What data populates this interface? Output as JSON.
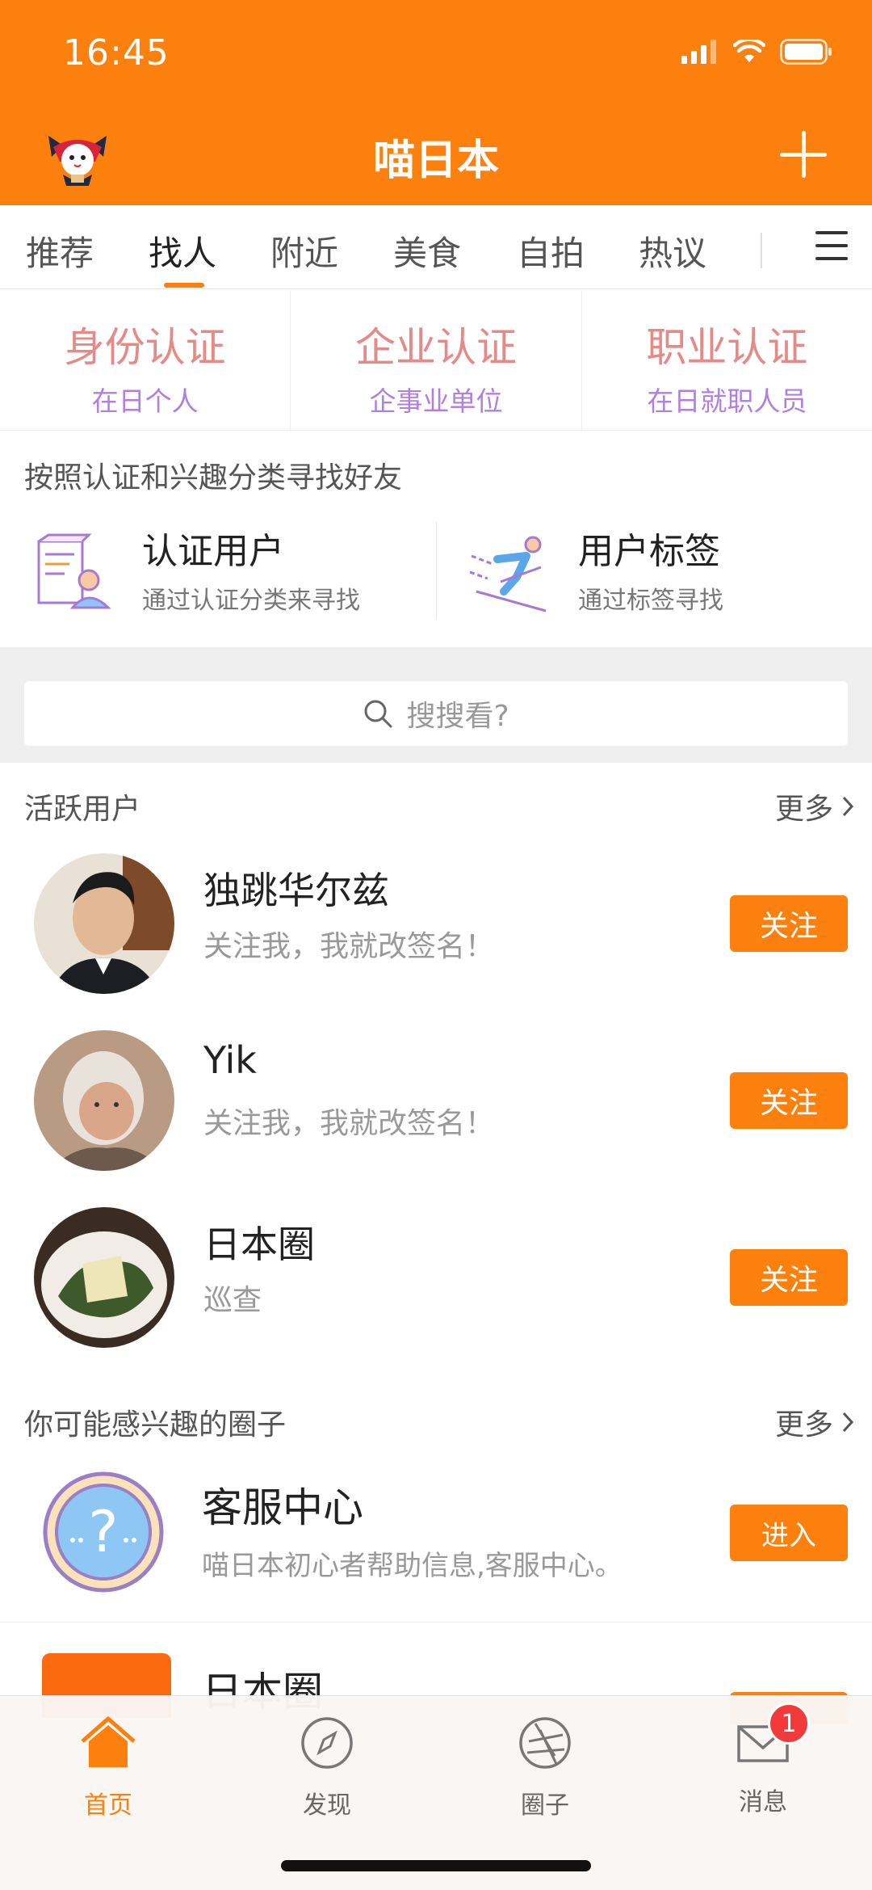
{
  "status_bar": {
    "time": "16:45"
  },
  "header": {
    "title": "喵日本"
  },
  "tabs": [
    {
      "label": "推荐"
    },
    {
      "label": "找人"
    },
    {
      "label": "附近"
    },
    {
      "label": "美食"
    },
    {
      "label": "自拍"
    },
    {
      "label": "热议"
    }
  ],
  "verification": [
    {
      "title": "身份认证",
      "subtitle": "在日个人"
    },
    {
      "title": "企业认证",
      "subtitle": "企事业单位"
    },
    {
      "title": "职业认证",
      "subtitle": "在日就职人员"
    }
  ],
  "categories": {
    "heading": "按照认证和兴趣分类寻找好友",
    "items": [
      {
        "title": "认证用户",
        "subtitle": "通过认证分类来寻找"
      },
      {
        "title": "用户标签",
        "subtitle": "通过标签寻找"
      }
    ]
  },
  "search": {
    "placeholder": "搜搜看?"
  },
  "active_users": {
    "heading": "活跃用户",
    "more": "更多",
    "users": [
      {
        "name": "独跳华尔兹",
        "signature": "关注我，我就改签名！",
        "button": "关注"
      },
      {
        "name": "Yik",
        "signature": "关注我，我就改签名！",
        "button": "关注"
      },
      {
        "name": "日本圈",
        "signature": "巡查",
        "button": "关注"
      }
    ]
  },
  "circles": {
    "heading": "你可能感兴趣的圈子",
    "more": "更多",
    "items": [
      {
        "title": "客服中心",
        "description": "喵日本初心者帮助信息,客服中心。",
        "button": "进入"
      },
      {
        "title": "日本圈"
      }
    ]
  },
  "bottom_nav": [
    {
      "label": "首页",
      "icon": "home-icon"
    },
    {
      "label": "发现",
      "icon": "compass-icon"
    },
    {
      "label": "圈子",
      "icon": "aperture-icon"
    },
    {
      "label": "消息",
      "icon": "mail-icon",
      "badge": "1"
    }
  ],
  "colors": {
    "accent": "#fb800e",
    "verify_title": "#e58a86",
    "verify_sub": "#b07fe0",
    "badge": "#f23a3a"
  }
}
